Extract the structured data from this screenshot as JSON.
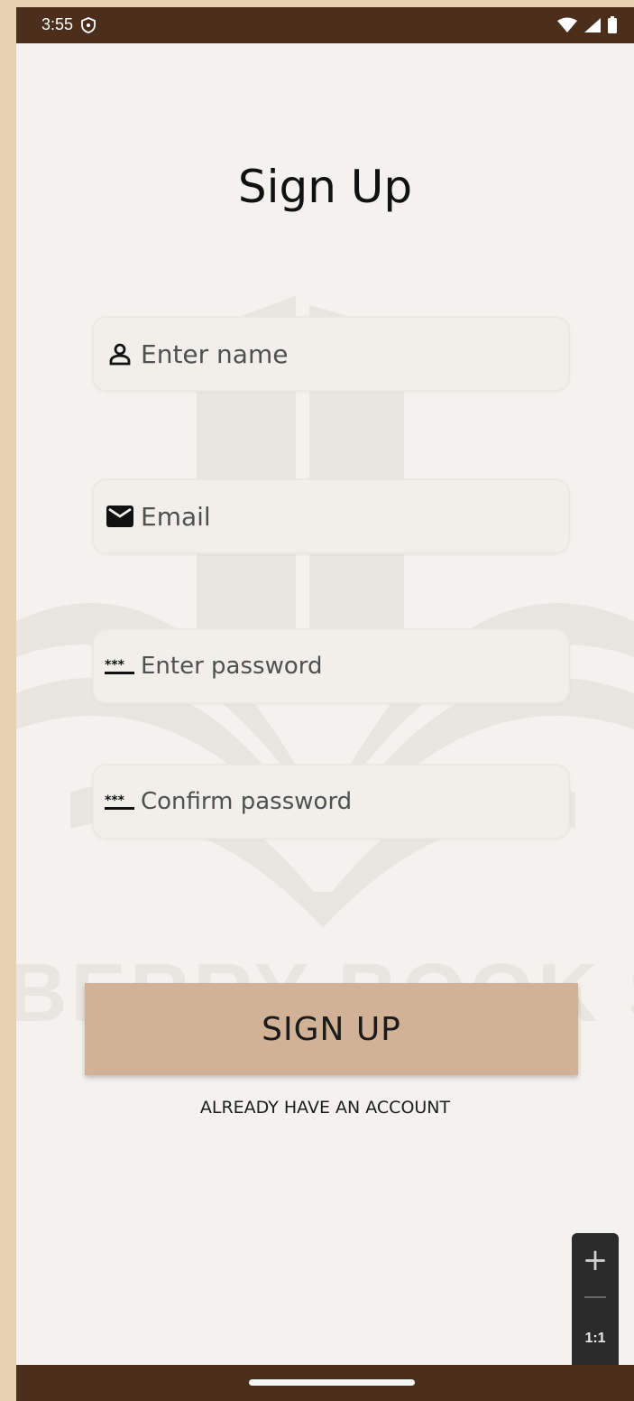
{
  "status_bar": {
    "time": "3:55"
  },
  "screen": {
    "title": "Sign Up"
  },
  "form": {
    "name_placeholder": "Enter name",
    "email_placeholder": "Email",
    "password_placeholder": "Enter password",
    "confirm_placeholder": "Confirm password",
    "name_icon": "person-icon",
    "email_icon": "mail-icon",
    "password_icon": "password-icon"
  },
  "actions": {
    "signup_label": "SIGN UP",
    "already_label": "ALREADY HAVE AN ACCOUNT"
  },
  "zoom_controls": {
    "plus": "+",
    "ratio": "1:1"
  },
  "colors": {
    "status_bar": "#4b2f1c",
    "background": "#f4f2ee",
    "button": "#d2b296",
    "outer": "#e6d2b0"
  }
}
